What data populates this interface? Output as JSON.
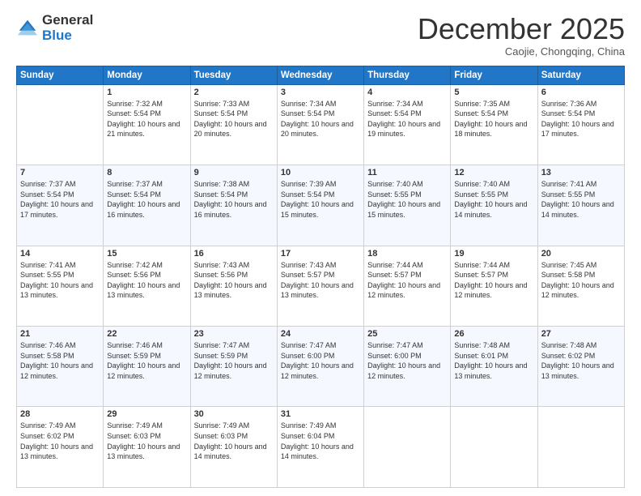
{
  "header": {
    "logo_general": "General",
    "logo_blue": "Blue",
    "month_title": "December 2025",
    "subtitle": "Caojie, Chongqing, China"
  },
  "days_of_week": [
    "Sunday",
    "Monday",
    "Tuesday",
    "Wednesday",
    "Thursday",
    "Friday",
    "Saturday"
  ],
  "weeks": [
    [
      {
        "num": "",
        "info": ""
      },
      {
        "num": "1",
        "info": "Sunrise: 7:32 AM\nSunset: 5:54 PM\nDaylight: 10 hours and 21 minutes."
      },
      {
        "num": "2",
        "info": "Sunrise: 7:33 AM\nSunset: 5:54 PM\nDaylight: 10 hours and 20 minutes."
      },
      {
        "num": "3",
        "info": "Sunrise: 7:34 AM\nSunset: 5:54 PM\nDaylight: 10 hours and 20 minutes."
      },
      {
        "num": "4",
        "info": "Sunrise: 7:34 AM\nSunset: 5:54 PM\nDaylight: 10 hours and 19 minutes."
      },
      {
        "num": "5",
        "info": "Sunrise: 7:35 AM\nSunset: 5:54 PM\nDaylight: 10 hours and 18 minutes."
      },
      {
        "num": "6",
        "info": "Sunrise: 7:36 AM\nSunset: 5:54 PM\nDaylight: 10 hours and 17 minutes."
      }
    ],
    [
      {
        "num": "7",
        "info": "Sunrise: 7:37 AM\nSunset: 5:54 PM\nDaylight: 10 hours and 17 minutes."
      },
      {
        "num": "8",
        "info": "Sunrise: 7:37 AM\nSunset: 5:54 PM\nDaylight: 10 hours and 16 minutes."
      },
      {
        "num": "9",
        "info": "Sunrise: 7:38 AM\nSunset: 5:54 PM\nDaylight: 10 hours and 16 minutes."
      },
      {
        "num": "10",
        "info": "Sunrise: 7:39 AM\nSunset: 5:54 PM\nDaylight: 10 hours and 15 minutes."
      },
      {
        "num": "11",
        "info": "Sunrise: 7:40 AM\nSunset: 5:55 PM\nDaylight: 10 hours and 15 minutes."
      },
      {
        "num": "12",
        "info": "Sunrise: 7:40 AM\nSunset: 5:55 PM\nDaylight: 10 hours and 14 minutes."
      },
      {
        "num": "13",
        "info": "Sunrise: 7:41 AM\nSunset: 5:55 PM\nDaylight: 10 hours and 14 minutes."
      }
    ],
    [
      {
        "num": "14",
        "info": "Sunrise: 7:41 AM\nSunset: 5:55 PM\nDaylight: 10 hours and 13 minutes."
      },
      {
        "num": "15",
        "info": "Sunrise: 7:42 AM\nSunset: 5:56 PM\nDaylight: 10 hours and 13 minutes."
      },
      {
        "num": "16",
        "info": "Sunrise: 7:43 AM\nSunset: 5:56 PM\nDaylight: 10 hours and 13 minutes."
      },
      {
        "num": "17",
        "info": "Sunrise: 7:43 AM\nSunset: 5:57 PM\nDaylight: 10 hours and 13 minutes."
      },
      {
        "num": "18",
        "info": "Sunrise: 7:44 AM\nSunset: 5:57 PM\nDaylight: 10 hours and 12 minutes."
      },
      {
        "num": "19",
        "info": "Sunrise: 7:44 AM\nSunset: 5:57 PM\nDaylight: 10 hours and 12 minutes."
      },
      {
        "num": "20",
        "info": "Sunrise: 7:45 AM\nSunset: 5:58 PM\nDaylight: 10 hours and 12 minutes."
      }
    ],
    [
      {
        "num": "21",
        "info": "Sunrise: 7:46 AM\nSunset: 5:58 PM\nDaylight: 10 hours and 12 minutes."
      },
      {
        "num": "22",
        "info": "Sunrise: 7:46 AM\nSunset: 5:59 PM\nDaylight: 10 hours and 12 minutes."
      },
      {
        "num": "23",
        "info": "Sunrise: 7:47 AM\nSunset: 5:59 PM\nDaylight: 10 hours and 12 minutes."
      },
      {
        "num": "24",
        "info": "Sunrise: 7:47 AM\nSunset: 6:00 PM\nDaylight: 10 hours and 12 minutes."
      },
      {
        "num": "25",
        "info": "Sunrise: 7:47 AM\nSunset: 6:00 PM\nDaylight: 10 hours and 12 minutes."
      },
      {
        "num": "26",
        "info": "Sunrise: 7:48 AM\nSunset: 6:01 PM\nDaylight: 10 hours and 13 minutes."
      },
      {
        "num": "27",
        "info": "Sunrise: 7:48 AM\nSunset: 6:02 PM\nDaylight: 10 hours and 13 minutes."
      }
    ],
    [
      {
        "num": "28",
        "info": "Sunrise: 7:49 AM\nSunset: 6:02 PM\nDaylight: 10 hours and 13 minutes."
      },
      {
        "num": "29",
        "info": "Sunrise: 7:49 AM\nSunset: 6:03 PM\nDaylight: 10 hours and 13 minutes."
      },
      {
        "num": "30",
        "info": "Sunrise: 7:49 AM\nSunset: 6:03 PM\nDaylight: 10 hours and 14 minutes."
      },
      {
        "num": "31",
        "info": "Sunrise: 7:49 AM\nSunset: 6:04 PM\nDaylight: 10 hours and 14 minutes."
      },
      {
        "num": "",
        "info": ""
      },
      {
        "num": "",
        "info": ""
      },
      {
        "num": "",
        "info": ""
      }
    ]
  ]
}
